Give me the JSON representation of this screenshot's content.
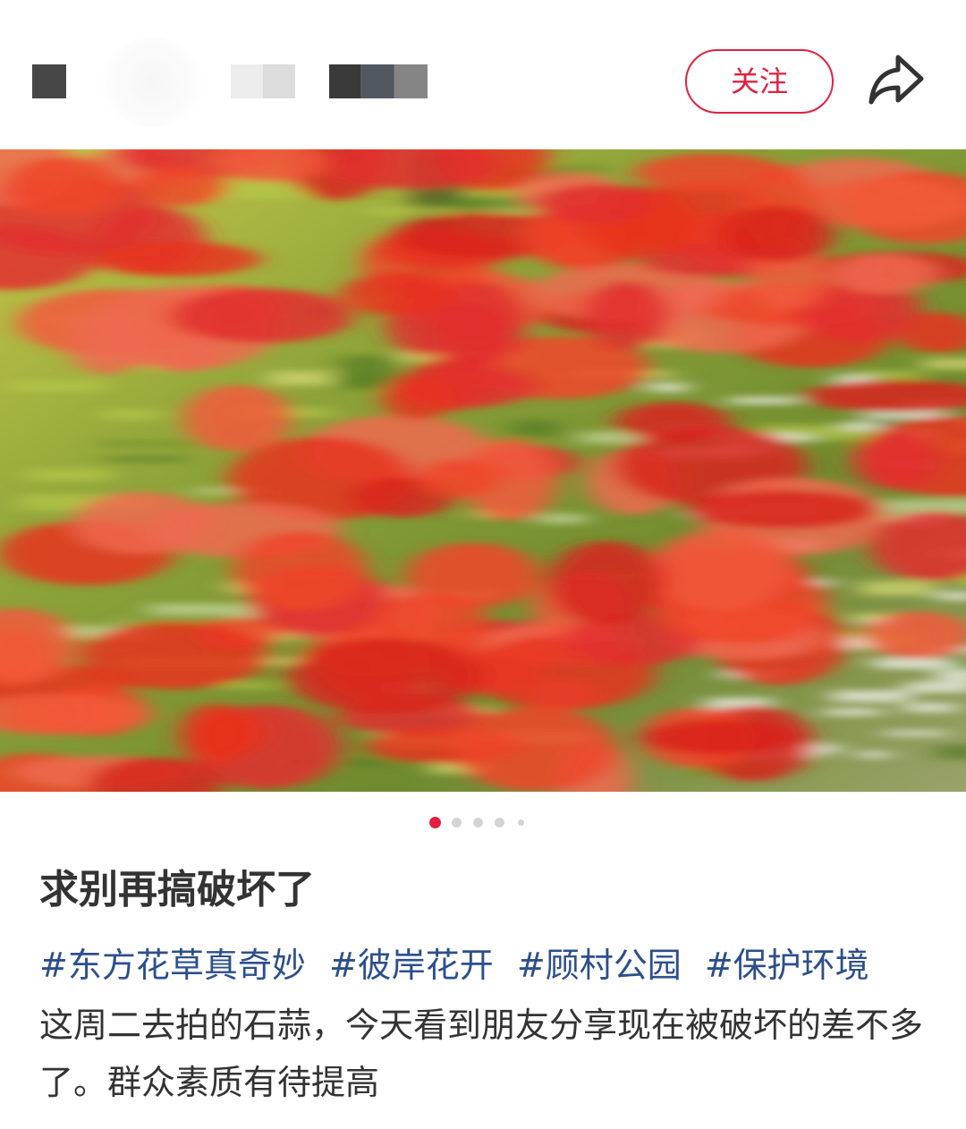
{
  "header": {
    "follow_label": "关注",
    "share_icon": "share-arrow-icon",
    "accent_color": "#e0213f"
  },
  "post": {
    "image_carousel": {
      "total": 5,
      "active_index": 0
    },
    "title": "求别再搞破坏了",
    "tags": [
      "#东方花草真奇妙",
      "#彼岸花开",
      "#顾村公园",
      "#保护环境"
    ],
    "body": "这周二去拍的石蒜，今天看到朋友分享现在被破坏的差不多了。群众素质有待提高"
  },
  "colors": {
    "tag": "#2c4f8c",
    "text": "#333333",
    "active_dot": "#e0213f"
  }
}
